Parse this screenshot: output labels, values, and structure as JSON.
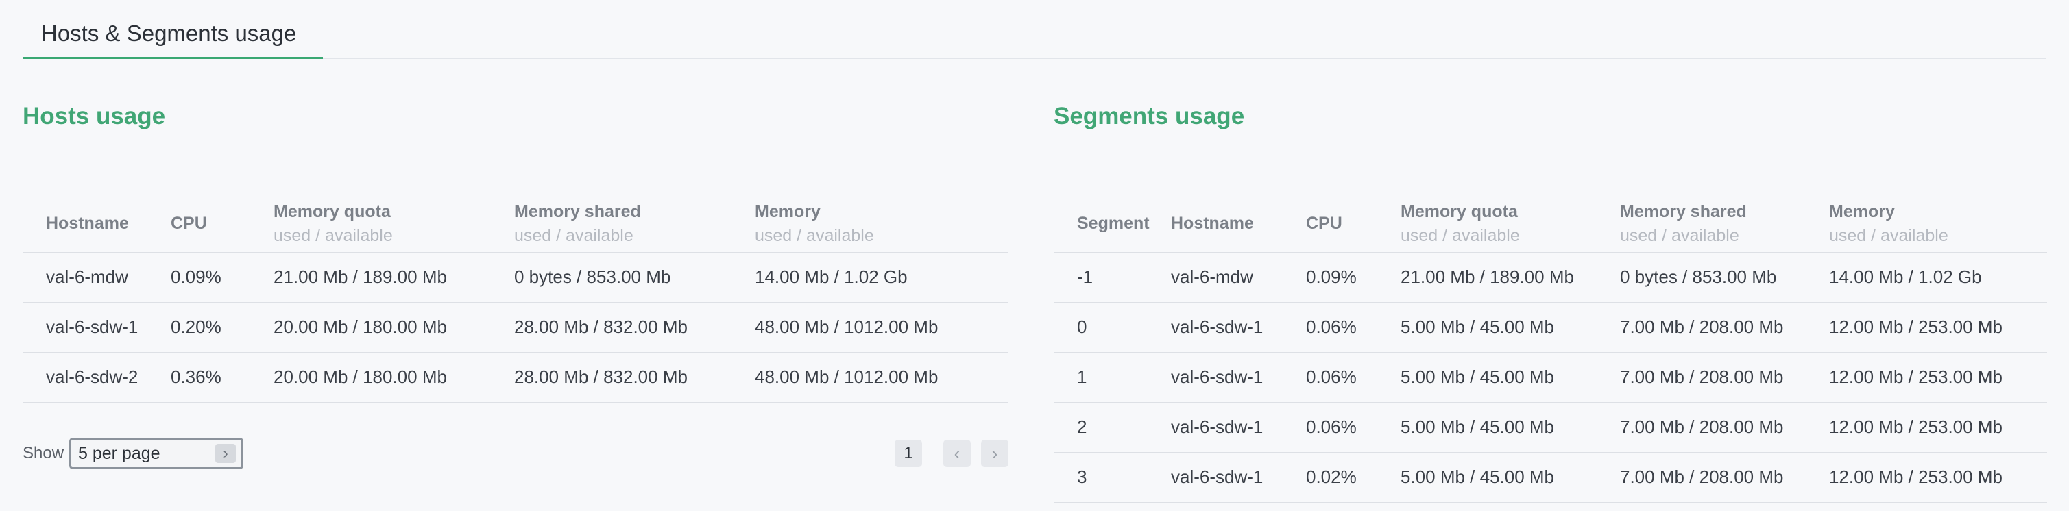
{
  "tab": {
    "label": "Hosts & Segments usage"
  },
  "hosts": {
    "title": "Hosts usage",
    "columns": [
      {
        "label": "Hostname",
        "sub": ""
      },
      {
        "label": "CPU",
        "sub": ""
      },
      {
        "label": "Memory quota",
        "sub": "used / available"
      },
      {
        "label": "Memory shared",
        "sub": "used / available"
      },
      {
        "label": "Memory",
        "sub": "used / available"
      }
    ],
    "rows": [
      [
        "val-6-mdw",
        "0.09%",
        "21.00 Mb / 189.00 Mb",
        "0 bytes / 853.00 Mb",
        "14.00 Mb / 1.02 Gb"
      ],
      [
        "val-6-sdw-1",
        "0.20%",
        "20.00 Mb / 180.00 Mb",
        "28.00 Mb / 832.00 Mb",
        "48.00 Mb / 1012.00 Mb"
      ],
      [
        "val-6-sdw-2",
        "0.36%",
        "20.00 Mb / 180.00 Mb",
        "28.00 Mb / 832.00 Mb",
        "48.00 Mb / 1012.00 Mb"
      ]
    ],
    "pager": {
      "show_label": "Show",
      "per_page": "5 per page",
      "page": "1",
      "prev": "‹",
      "next": "›",
      "select_chevron": "›"
    }
  },
  "segments": {
    "title": "Segments usage",
    "columns": [
      {
        "label": "Segment",
        "sub": ""
      },
      {
        "label": "Hostname",
        "sub": ""
      },
      {
        "label": "CPU",
        "sub": ""
      },
      {
        "label": "Memory quota",
        "sub": "used / available"
      },
      {
        "label": "Memory shared",
        "sub": "used / available"
      },
      {
        "label": "Memory",
        "sub": "used / available"
      }
    ],
    "rows": [
      [
        "-1",
        "val-6-mdw",
        "0.09%",
        "21.00 Mb / 189.00 Mb",
        "0 bytes / 853.00 Mb",
        "14.00 Mb / 1.02 Gb"
      ],
      [
        "0",
        "val-6-sdw-1",
        "0.06%",
        "5.00 Mb / 45.00 Mb",
        "7.00 Mb / 208.00 Mb",
        "12.00 Mb / 253.00 Mb"
      ],
      [
        "1",
        "val-6-sdw-1",
        "0.06%",
        "5.00 Mb / 45.00 Mb",
        "7.00 Mb / 208.00 Mb",
        "12.00 Mb / 253.00 Mb"
      ],
      [
        "2",
        "val-6-sdw-1",
        "0.06%",
        "5.00 Mb / 45.00 Mb",
        "7.00 Mb / 208.00 Mb",
        "12.00 Mb / 253.00 Mb"
      ],
      [
        "3",
        "val-6-sdw-1",
        "0.02%",
        "5.00 Mb / 45.00 Mb",
        "7.00 Mb / 208.00 Mb",
        "12.00 Mb / 253.00 Mb"
      ]
    ]
  }
}
